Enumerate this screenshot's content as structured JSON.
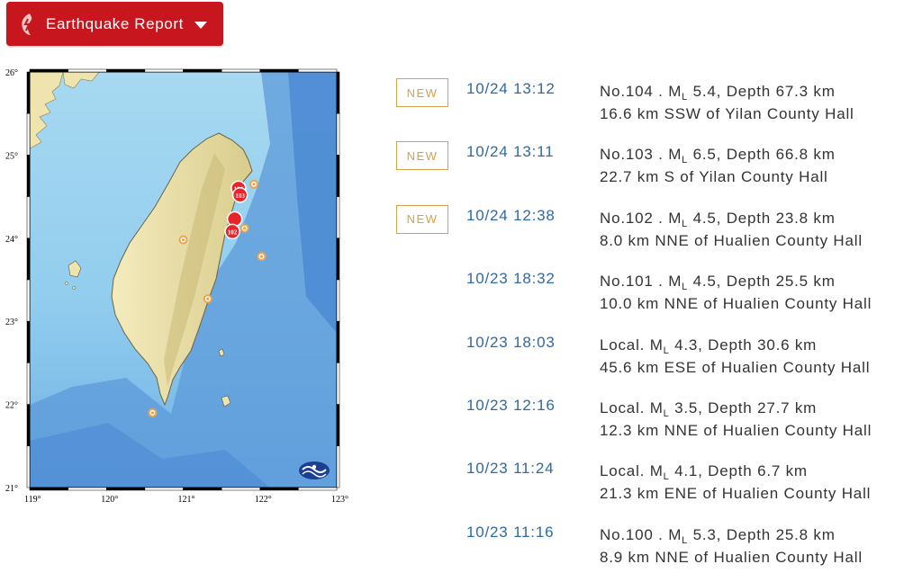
{
  "header": {
    "button_label": "Earthquake Report"
  },
  "map": {
    "lat_labels": [
      "26°",
      "25°",
      "24°",
      "23°",
      "22°",
      "21°"
    ],
    "lon_labels": [
      "119°",
      "120°",
      "121°",
      "122°",
      "123°"
    ],
    "event_markers": [
      {
        "label": "104",
        "lon": 121.72,
        "lat": 24.6,
        "new": true
      },
      {
        "label": "103",
        "lon": 121.74,
        "lat": 24.52,
        "new": true
      },
      {
        "label": "",
        "lon": 121.67,
        "lat": 24.23,
        "new": true
      },
      {
        "label": "102",
        "lon": 121.64,
        "lat": 24.08,
        "new": true
      },
      {
        "label": "",
        "lon": 121.92,
        "lat": 24.65,
        "new": false
      },
      {
        "label": "",
        "lon": 121.8,
        "lat": 24.12,
        "new": false
      },
      {
        "label": "",
        "lon": 122.02,
        "lat": 23.78,
        "new": false
      },
      {
        "label": "",
        "lon": 121.0,
        "lat": 23.98,
        "new": false
      },
      {
        "label": "",
        "lon": 121.32,
        "lat": 23.27,
        "new": false
      },
      {
        "label": "",
        "lon": 120.6,
        "lat": 21.9,
        "new": false
      }
    ],
    "colors": {
      "sea": "#9fd4ee",
      "land": "#efe4ad",
      "deep_sea": "#4f8fd6",
      "marker_new": "#e8242b",
      "marker_old": "#f0a44a"
    }
  },
  "reports": [
    {
      "badge": "NEW",
      "time": "10/24 13:12",
      "id": "No.104 .",
      "mag_prefix": "M",
      "mag_sub": "L",
      "mag_rest": " 5.4, Depth 67.3 km",
      "location": "16.6 km SSW of Yilan County Hall"
    },
    {
      "badge": "NEW",
      "time": "10/24 13:11",
      "id": "No.103 .",
      "mag_prefix": "M",
      "mag_sub": "L",
      "mag_rest": " 6.5, Depth 66.8 km",
      "location": "22.7 km S of Yilan County Hall"
    },
    {
      "badge": "NEW",
      "time": "10/24 12:38",
      "id": "No.102 .",
      "mag_prefix": "M",
      "mag_sub": "L",
      "mag_rest": " 4.5, Depth 23.8 km",
      "location": "8.0 km NNE of Hualien County Hall"
    },
    {
      "badge": "",
      "time": "10/23 18:32",
      "id": "No.101 .",
      "mag_prefix": "M",
      "mag_sub": "L",
      "mag_rest": " 4.5, Depth 25.5 km",
      "location": "10.0 km NNE of Hualien County Hall"
    },
    {
      "badge": "",
      "time": "10/23 18:03",
      "id": "Local.",
      "mag_prefix": "M",
      "mag_sub": "L",
      "mag_rest": " 4.3, Depth 30.6 km",
      "location": "45.6 km ESE of Hualien County Hall"
    },
    {
      "badge": "",
      "time": "10/23 12:16",
      "id": "Local.",
      "mag_prefix": "M",
      "mag_sub": "L",
      "mag_rest": " 3.5, Depth 27.7 km",
      "location": "12.3 km NNE of Hualien County Hall"
    },
    {
      "badge": "",
      "time": "10/23 11:24",
      "id": "Local.",
      "mag_prefix": "M",
      "mag_sub": "L",
      "mag_rest": " 4.1, Depth 6.7 km",
      "location": "21.3 km ENE of Hualien County Hall"
    },
    {
      "badge": "",
      "time": "10/23 11:16",
      "id": "No.100 .",
      "mag_prefix": "M",
      "mag_sub": "L",
      "mag_rest": " 5.3, Depth 25.8 km",
      "location": "8.9 km NNE of Hualien County Hall"
    }
  ]
}
